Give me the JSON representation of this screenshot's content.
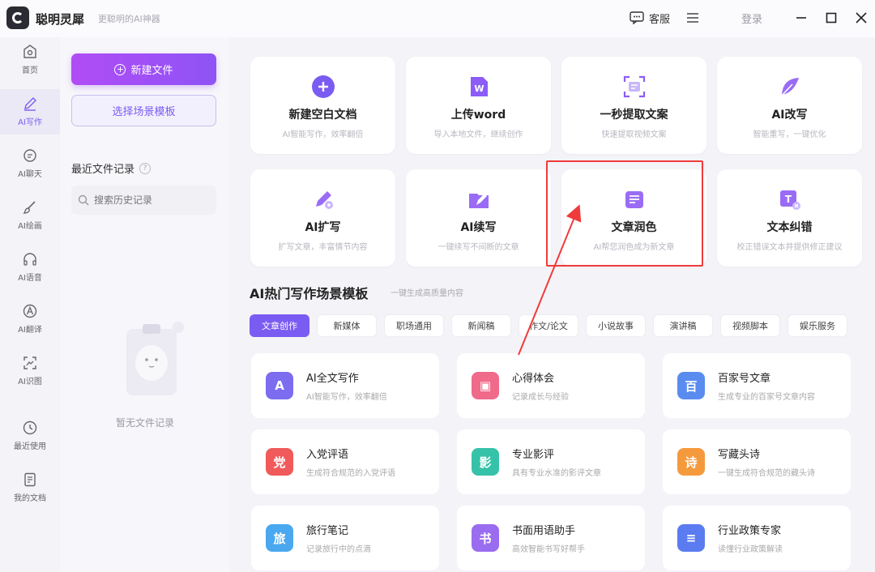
{
  "titlebar": {
    "app_name": "聪明灵犀",
    "slogan": "更聪明的AI神器",
    "service_label": "客服",
    "login_label": "登录"
  },
  "nav": {
    "items": [
      {
        "label": "首页",
        "icon": "home-icon"
      },
      {
        "label": "AI写作",
        "icon": "pen-icon"
      },
      {
        "label": "AI聊天",
        "icon": "chat-icon"
      },
      {
        "label": "AI绘画",
        "icon": "brush-icon"
      },
      {
        "label": "AI语音",
        "icon": "headphone-icon"
      },
      {
        "label": "AI翻译",
        "icon": "translate-icon"
      },
      {
        "label": "AI识图",
        "icon": "image-scan-icon"
      },
      {
        "label": "最近使用",
        "icon": "clock-icon"
      },
      {
        "label": "我的文档",
        "icon": "document-icon"
      }
    ],
    "active_index": 1
  },
  "sidepanel": {
    "new_file_label": "新建文件",
    "template_label": "选择场景模板",
    "recent_title": "最近文件记录",
    "search_placeholder": "搜索历史记录",
    "empty_text": "暂无文件记录"
  },
  "quick_cards": [
    {
      "title": "新建空白文档",
      "desc": "AI智能写作，效率翻倍",
      "icon": "plus-circle-icon"
    },
    {
      "title": "上传word",
      "desc": "导入本地文件，继续创作",
      "icon": "word-icon"
    },
    {
      "title": "一秒提取文案",
      "desc": "快速提取视频文案",
      "icon": "scan-text-icon"
    },
    {
      "title": "AI改写",
      "desc": "智能重写，一键优化",
      "icon": "feather-icon"
    },
    {
      "title": "AI扩写",
      "desc": "扩写文章，丰富情节内容",
      "icon": "expand-pen-icon"
    },
    {
      "title": "AI续写",
      "desc": "一键续写不间断的文章",
      "icon": "continue-write-icon"
    },
    {
      "title": "文章润色",
      "desc": "AI帮您润色成为新文章",
      "icon": "polish-icon"
    },
    {
      "title": "文本纠错",
      "desc": "校正错误文本并提供修正建议",
      "icon": "text-correct-icon"
    }
  ],
  "templates_section": {
    "title": "AI热门写作场景模板",
    "subtitle": "一键生成高质量内容",
    "tabs": [
      "文章创作",
      "新媒体",
      "职场通用",
      "新闻稿",
      "作文/论文",
      "小说故事",
      "演讲稿",
      "视频脚本",
      "娱乐服务"
    ],
    "active_tab": 0
  },
  "scene_cards": [
    {
      "title": "AI全文写作",
      "desc": "AI智能写作，效率翻倍",
      "icon": "ai-write-icon",
      "glyph": "A",
      "color": "#7b6cf0"
    },
    {
      "title": "心得体会",
      "desc": "记录成长与经验",
      "icon": "notebook-icon",
      "glyph": "▣",
      "color": "#f06a8a"
    },
    {
      "title": "百家号文章",
      "desc": "生成专业的百家号文章内容",
      "icon": "baijiahao-icon",
      "glyph": "百",
      "color": "#5a8cf0"
    },
    {
      "title": "入党评语",
      "desc": "生成符合规范的入党评语",
      "icon": "party-icon",
      "glyph": "党",
      "color": "#f05a5a"
    },
    {
      "title": "专业影评",
      "desc": "具有专业水准的影评文章",
      "icon": "film-icon",
      "glyph": "影",
      "color": "#36c2a8"
    },
    {
      "title": "写藏头诗",
      "desc": "一键生成符合规范的藏头诗",
      "icon": "poem-icon",
      "glyph": "诗",
      "color": "#f59a3c"
    },
    {
      "title": "旅行笔记",
      "desc": "记录旅行中的点滴",
      "icon": "travel-icon",
      "glyph": "旅",
      "color": "#4aa8f0"
    },
    {
      "title": "书面用语助手",
      "desc": "高效智能书写好帮手",
      "icon": "book-icon",
      "glyph": "书",
      "color": "#9a6cf0"
    },
    {
      "title": "行业政策专家",
      "desc": "读懂行业政策解读",
      "icon": "policy-icon",
      "glyph": "≡",
      "color": "#5a7cf0"
    }
  ],
  "colors": {
    "accent": "#7b5cf2",
    "highlight": "#ef3b3b"
  }
}
